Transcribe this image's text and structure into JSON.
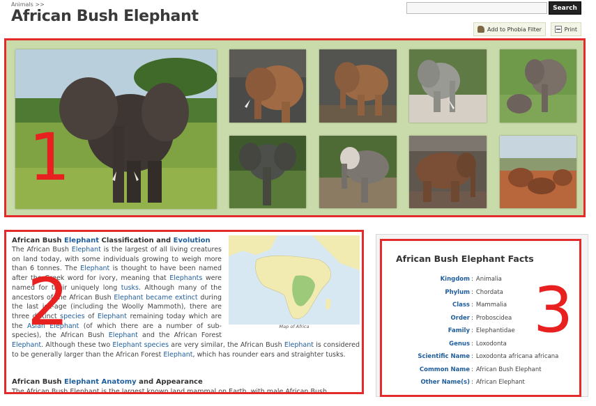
{
  "breadcrumb": "Animals >>",
  "page_title": "African Bush Elephant",
  "search": {
    "placeholder": "",
    "button_label": "Search"
  },
  "toolbar": {
    "phobia_label": "Add to Phobia Filter",
    "print_label": "Print"
  },
  "annotations": {
    "gallery": "1",
    "article": "2",
    "facts": "3"
  },
  "colors": {
    "highlight_red": "#e32b2b",
    "gallery_bg": "#c9dbaa",
    "link": "#1f5d9c"
  },
  "article": {
    "heading1": {
      "t1": "African Bush ",
      "l1": "Elephant",
      "t2": " Classification and ",
      "l2": "Evolution"
    },
    "para1": {
      "s1": "The African Bush ",
      "l_elephant1": "Elephant",
      "s2": " is the largest of all living creatures on land today, with some individuals growing to weigh more than 6 tonnes. The ",
      "l_elephant2": "Elephant",
      "s3": " is thought to have been named after the Greek word for ivory, meaning that ",
      "l_elephants": "Elephants",
      "s4": " were named for their uniquely long ",
      "l_tusks": "tusks",
      "s5": ". Although many of the ancestors of the African Bush ",
      "l_elephant3": "Elephant",
      "s6": " ",
      "l_extinct": "became extinct",
      "s7": " during the last ice-age (including the Woolly Mammoth), there are three distinct ",
      "l_species": "species",
      "s8": " of ",
      "l_elephant4": "Elephant",
      "s9": " remaining today which are the ",
      "l_asian": "Asian Elephant",
      "s10": " (of which there are a number of sub-species), the African Bush ",
      "l_elephant5": "Elephant",
      "s11": " and the African Forest ",
      "l_elephant6": "Elephant",
      "s12": ". Although these two ",
      "l_elephant7": "Elephant",
      "s13": " ",
      "l_species2": "species",
      "s14": " are very similar, the African Bush ",
      "l_elephant8": "Elephant",
      "s15": " is considered to be generally larger than the African Forest ",
      "l_elephant9": "Elephant",
      "s16": ", which has rounder ears and straighter tusks."
    },
    "heading2": {
      "t1": "African Bush ",
      "l1": "Elephant",
      "t2": " ",
      "l2": "Anatomy",
      "t3": " and Appearance"
    },
    "para2_partial": "The African Bush Elephant is the largest known land mammal on Earth, with male African Bush",
    "map_caption": "Map of Africa"
  },
  "facts": {
    "title": "African Bush Elephant Facts",
    "rows": [
      {
        "label": "Kingdom",
        "value": "Animalia"
      },
      {
        "label": "Phylum",
        "value": "Chordata"
      },
      {
        "label": "Class",
        "value": "Mammalia"
      },
      {
        "label": "Order",
        "value": "Proboscidea"
      },
      {
        "label": "Family",
        "value": "Elephantidae"
      },
      {
        "label": "Genus",
        "value": "Loxodonta"
      },
      {
        "label": "Scientific Name",
        "value": "Loxodonta africana africana"
      },
      {
        "label": "Common Name",
        "value": "African Bush Elephant"
      },
      {
        "label": "Other Name(s)",
        "value": "African Elephant"
      }
    ]
  }
}
